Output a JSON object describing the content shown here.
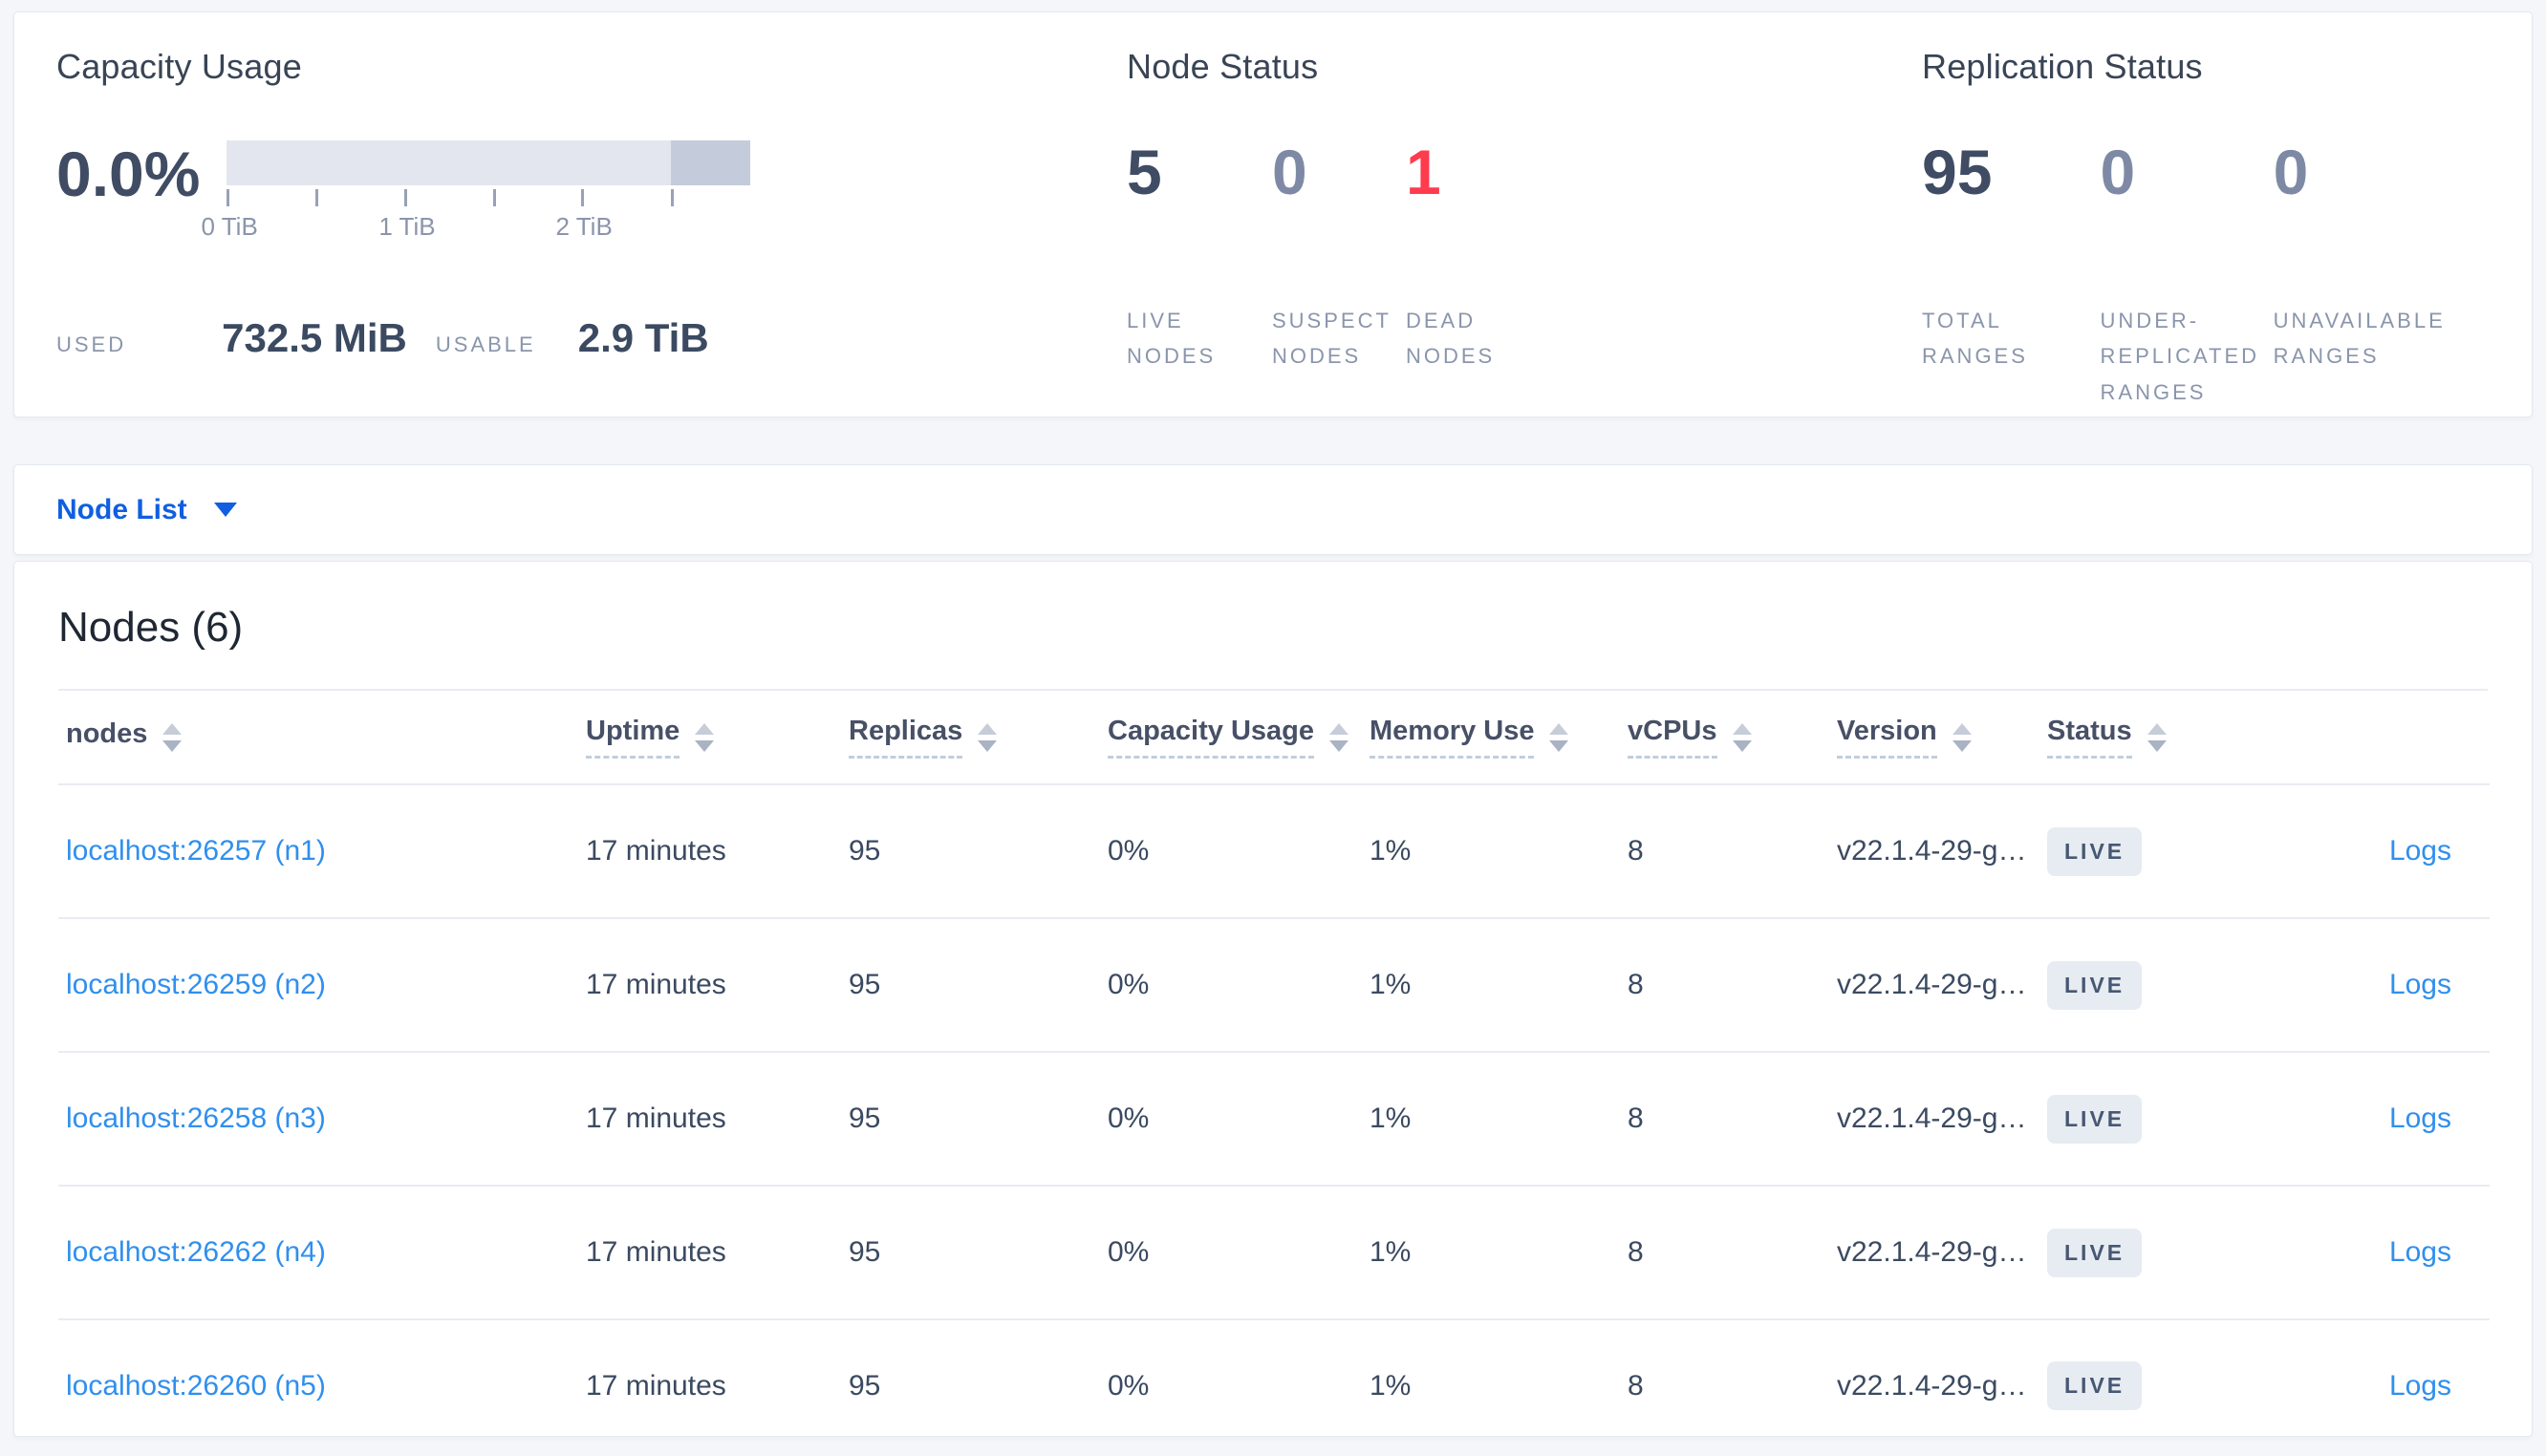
{
  "overview_panels": {
    "capacity": {
      "title": "Capacity Usage",
      "percent_used": "0.0%",
      "axis_tick_labels": [
        "0 TiB",
        "1 TiB",
        "2 TiB"
      ],
      "used_label": "USED",
      "used_value": "732.5 MiB",
      "usable_label": "USABLE",
      "usable_value": "2.9 TiB",
      "chart": {
        "type": "bar",
        "usable_total": "2.9 TiB",
        "dark_segment_fraction": 0.153
      }
    },
    "node_status": {
      "title": "Node Status",
      "stats": [
        {
          "value": "5",
          "label": "LIVE NODES"
        },
        {
          "value": "0",
          "label": "SUSPECT NODES"
        },
        {
          "value": "1",
          "label": "DEAD NODES"
        }
      ]
    },
    "replication_status": {
      "title": "Replication Status",
      "stats": [
        {
          "value": "95",
          "label": "TOTAL RANGES"
        },
        {
          "value": "0",
          "label": "UNDER-REPLICATED RANGES"
        },
        {
          "value": "0",
          "label": "UNAVAILABLE RANGES"
        }
      ]
    }
  },
  "view_selector": {
    "selected": "Node List"
  },
  "nodes_table": {
    "title": "Nodes (6)",
    "columns": [
      {
        "label": "nodes"
      },
      {
        "label": "Uptime"
      },
      {
        "label": "Replicas"
      },
      {
        "label": "Capacity Usage"
      },
      {
        "label": "Memory Use"
      },
      {
        "label": "vCPUs"
      },
      {
        "label": "Version"
      },
      {
        "label": "Status"
      },
      {
        "label": ""
      }
    ],
    "rows": [
      {
        "node": "localhost:26257 (n1)",
        "uptime": "17 minutes",
        "replicas": "95",
        "capacity_usage": "0%",
        "memory_use": "1%",
        "vcpus": "8",
        "version": "v22.1.4-29-g…",
        "status": "LIVE",
        "logs": "Logs"
      },
      {
        "node": "localhost:26259 (n2)",
        "uptime": "17 minutes",
        "replicas": "95",
        "capacity_usage": "0%",
        "memory_use": "1%",
        "vcpus": "8",
        "version": "v22.1.4-29-g…",
        "status": "LIVE",
        "logs": "Logs"
      },
      {
        "node": "localhost:26258 (n3)",
        "uptime": "17 minutes",
        "replicas": "95",
        "capacity_usage": "0%",
        "memory_use": "1%",
        "vcpus": "8",
        "version": "v22.1.4-29-g…",
        "status": "LIVE",
        "logs": "Logs"
      },
      {
        "node": "localhost:26262 (n4)",
        "uptime": "17 minutes",
        "replicas": "95",
        "capacity_usage": "0%",
        "memory_use": "1%",
        "vcpus": "8",
        "version": "v22.1.4-29-g…",
        "status": "LIVE",
        "logs": "Logs"
      },
      {
        "node": "localhost:26260 (n5)",
        "uptime": "17 minutes",
        "replicas": "95",
        "capacity_usage": "0%",
        "memory_use": "1%",
        "vcpus": "8",
        "version": "v22.1.4-29-g…",
        "status": "LIVE",
        "logs": "Logs"
      }
    ]
  },
  "colors": {
    "accent_blue": "#105fe0",
    "link_blue": "#2f8fee",
    "danger_red": "#ff3b4e",
    "dark_slate": "#3f4c63",
    "muted_slate": "#7e8aa5",
    "badge_bg": "#e7ecf3",
    "bar_light": "#e3e6ee",
    "bar_dark": "#c4cbda"
  }
}
